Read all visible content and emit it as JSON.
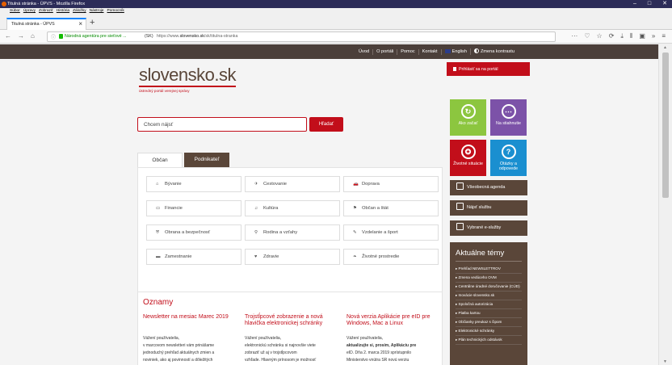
{
  "browser": {
    "window_title": "Titulná stránka - ÚPVS - Mozilla Firefox",
    "window_controls": [
      "–",
      "□",
      "✕"
    ],
    "menu": [
      "Súbor",
      "Úpravy",
      "Zobraziť",
      "História",
      "Záložky",
      "Nástroje",
      "Pomocník"
    ],
    "tab_title": "Titulná stránka - ÚPVS",
    "tab_close": "×",
    "new_tab": "+",
    "nav": {
      "back": "←",
      "forward": "→",
      "home": "⌂"
    },
    "url_info": "ⓘ",
    "site_identity": "Národná agentúra pre sieťové ...",
    "site_country": "(SK)",
    "url_prefix": "https://www.",
    "url_domain": "slovensko.sk",
    "url_path": "/sk/titulna-stranka",
    "toolbar_icons": [
      "···",
      "♡",
      "☆",
      "⟳",
      "⤓",
      "⫴",
      "▣",
      "»",
      "≡"
    ]
  },
  "topnav": {
    "links": [
      "Úvod",
      "O portáli",
      "Pomoc",
      "Kontakt",
      "English",
      "Zmena kontrastu"
    ]
  },
  "logo": {
    "name": "slovensko.sk",
    "subtitle": "ústredný portál verejnej správy"
  },
  "login": {
    "label": "Prihlásiť sa na portál"
  },
  "search": {
    "placeholder": "Chcem nájsť",
    "button": "Hľadať"
  },
  "tiles": [
    {
      "label": "Ako začať",
      "icon": "↻"
    },
    {
      "label": "Na stiahnutie",
      "icon": "⋯"
    },
    {
      "label": "Životné situácie",
      "icon": "✪"
    },
    {
      "label": "Otázky a odpovede",
      "icon": "?"
    }
  ],
  "tabs": {
    "citizen": "Občan",
    "business": "Podnikateľ"
  },
  "categories": [
    {
      "label": "Bývanie",
      "icon": "⌂"
    },
    {
      "label": "Cestovanie",
      "icon": "✈"
    },
    {
      "label": "Doprava",
      "icon": "🚗"
    },
    {
      "label": "Financie",
      "icon": "▭"
    },
    {
      "label": "Kultúra",
      "icon": "♫"
    },
    {
      "label": "Občan a štát",
      "icon": "⚑"
    },
    {
      "label": "Obrana a bezpečnosť",
      "icon": "⛨"
    },
    {
      "label": "Rodina a vzťahy",
      "icon": "⚲"
    },
    {
      "label": "Vzdelanie a šport",
      "icon": "✎"
    },
    {
      "label": "Zamestnanie",
      "icon": "▬"
    },
    {
      "label": "Zdravie",
      "icon": "♥"
    },
    {
      "label": "Životné prostredie",
      "icon": "❧"
    }
  ],
  "side_buttons": [
    "Všeobecná agenda",
    "Nájsť službu",
    "Vybrané e-služby"
  ],
  "topics": {
    "heading": "Aktuálne témy",
    "items": [
      "Prehľad NEWSLETTROV",
      "Zmena vedúceho OVM",
      "Centrálne úradné doručovanie (CÚD)",
      "Inovácie slovensko.sk",
      "Spoločná autorizácia",
      "Platba kartou",
      "Občianky preukaz s čipom",
      "Elektronické schránky",
      "Plán technických odstávok"
    ]
  },
  "news": {
    "heading": "Oznamy",
    "items": [
      {
        "title": "Newsletter na mesiac Marec 2019",
        "greeting": "Vážení používatelia,",
        "text": [
          "v marcovom newsletteri vám prinášame",
          "jednoduchý prehľad aktuálnych zmien a",
          "noviniek, ako aj povinností a dôležitých"
        ]
      },
      {
        "title": "Trojstĺpcové zobrazenie a nová hlavička elektronickej schránky",
        "greeting": "Vážení používatelia,",
        "text": [
          "elektronickú schránku si najnovšie viete",
          "zobraziť už aj v trojstĺpcovom",
          "vzhľade. Hlavným prínosom je možnosť"
        ]
      },
      {
        "title": "Nová verzia Aplikácie pre eID pre Windows, Mac a Linux",
        "greeting": "Vážení používatelia,",
        "text": [
          "aktualizujte si, prosím, Aplikáciu pre",
          "eID. Dňa 2. marca 2019 sprístupnilo",
          "Ministerstvo vnútra SR novú verziu"
        ]
      }
    ]
  },
  "colors": {
    "brand_red": "#c20e1a",
    "brand_brown": "#5a4639",
    "topnav_brown": "#4b3f3a"
  }
}
